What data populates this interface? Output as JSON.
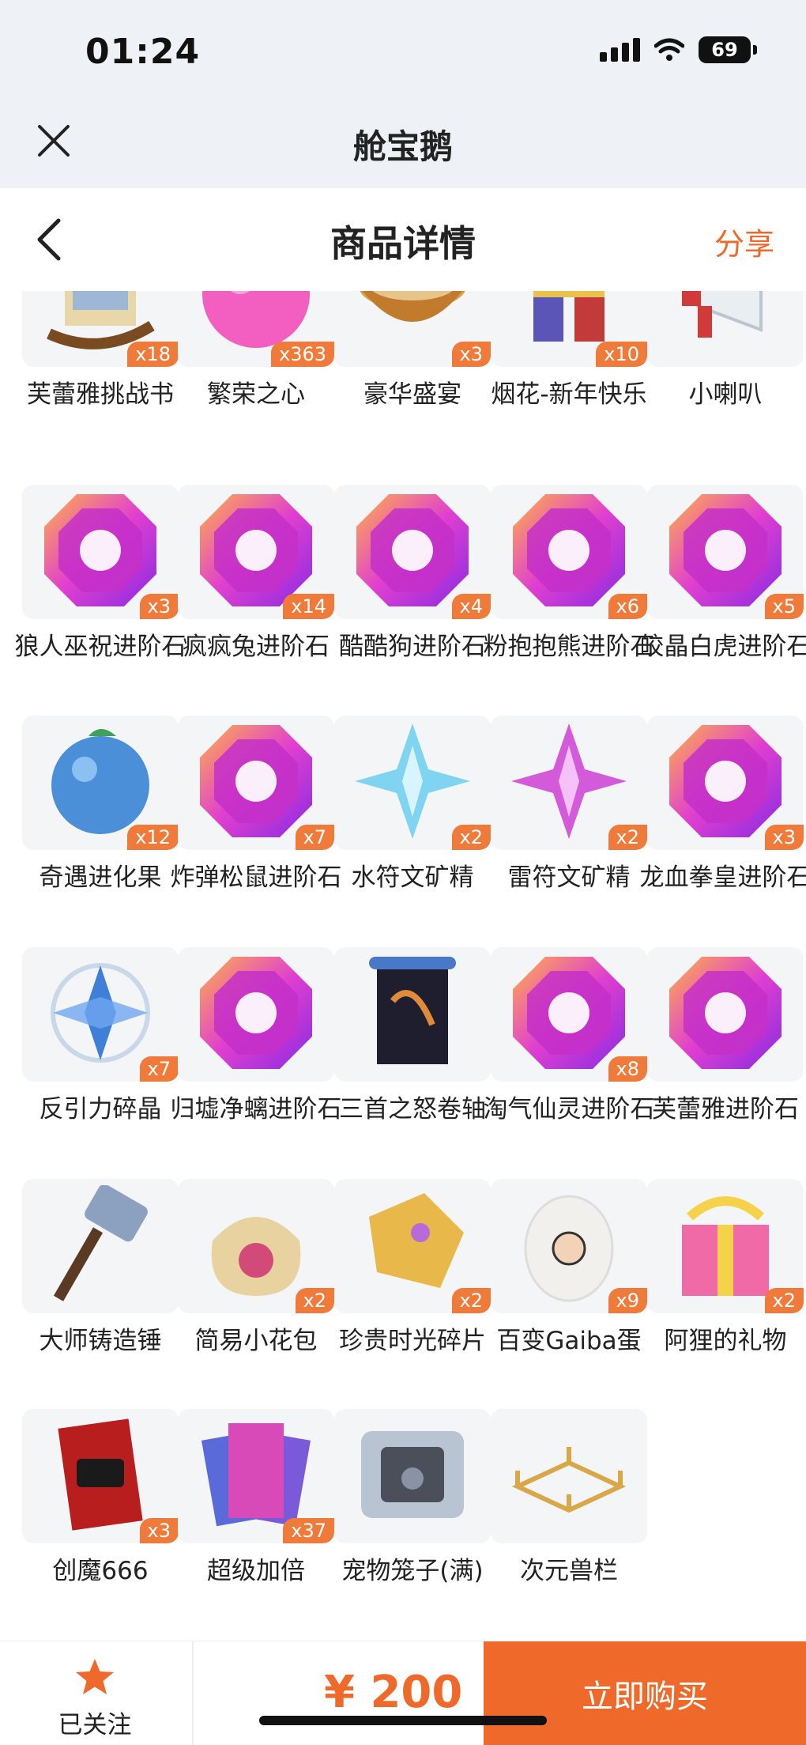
{
  "status_bar": {
    "time": "01:24",
    "battery": "69"
  },
  "app": {
    "title": "舱宝鹅"
  },
  "header": {
    "title": "商品详情",
    "share_label": "分享"
  },
  "items": [
    {
      "name": "芙蕾雅挑战书",
      "qty": "x18",
      "icon": "wanted-poster-icon"
    },
    {
      "name": "繁荣之心",
      "qty": "x363",
      "icon": "pink-heart-orb-icon"
    },
    {
      "name": "豪华盛宴",
      "qty": "x3",
      "icon": "feast-bowl-icon"
    },
    {
      "name": "烟花-新年快乐",
      "qty": "x10",
      "icon": "fireworks-icon"
    },
    {
      "name": "小喇叭",
      "qty": "",
      "icon": "megaphone-icon"
    },
    {
      "name": "狼人巫祝进阶石",
      "qty": "x3",
      "icon": "evolution-stone-icon"
    },
    {
      "name": "疯疯兔进阶石",
      "qty": "x14",
      "icon": "evolution-stone-icon"
    },
    {
      "name": "酷酷狗进阶石",
      "qty": "x4",
      "icon": "evolution-stone-icon"
    },
    {
      "name": "粉抱抱熊进阶石",
      "qty": "x6",
      "icon": "evolution-stone-icon"
    },
    {
      "name": "皎晶白虎进阶石",
      "qty": "x5",
      "icon": "evolution-stone-icon"
    },
    {
      "name": "奇遇进化果",
      "qty": "x12",
      "icon": "blue-fruit-icon"
    },
    {
      "name": "炸弹松鼠进阶石",
      "qty": "x7",
      "icon": "evolution-stone-icon"
    },
    {
      "name": "水符文矿精",
      "qty": "x2",
      "icon": "blue-crystal-icon"
    },
    {
      "name": "雷符文矿精",
      "qty": "x2",
      "icon": "purple-crystal-icon"
    },
    {
      "name": "龙血拳皇进阶石",
      "qty": "x3",
      "icon": "evolution-stone-icon"
    },
    {
      "name": "反引力碎晶",
      "qty": "x7",
      "icon": "anti-gravity-shard-icon"
    },
    {
      "name": "归墟净螭进阶石",
      "qty": "",
      "icon": "evolution-stone-icon"
    },
    {
      "name": "三首之怒卷轴",
      "qty": "",
      "icon": "scroll-icon"
    },
    {
      "name": "淘气仙灵进阶石",
      "qty": "x8",
      "icon": "evolution-stone-icon"
    },
    {
      "name": "芙蕾雅进阶石",
      "qty": "",
      "icon": "evolution-stone-icon"
    },
    {
      "name": "大师铸造锤",
      "qty": "",
      "icon": "hammer-icon"
    },
    {
      "name": "简易小花包",
      "qty": "x2",
      "icon": "flower-bag-icon"
    },
    {
      "name": "珍贵时光碎片",
      "qty": "x2",
      "icon": "time-shard-icon"
    },
    {
      "name": "百变Gaiba蛋",
      "qty": "x9",
      "icon": "egg-icon"
    },
    {
      "name": "阿狸的礼物",
      "qty": "x2",
      "icon": "gift-box-icon"
    },
    {
      "name": "创魔666",
      "qty": "x3",
      "icon": "card-666-icon"
    },
    {
      "name": "超级加倍",
      "qty": "x37",
      "icon": "super-double-cards-icon"
    },
    {
      "name": "宠物笼子(满)",
      "qty": "",
      "icon": "pet-cage-icon"
    },
    {
      "name": "次元兽栏",
      "qty": "",
      "icon": "fence-icon"
    }
  ],
  "bottom": {
    "follow_label": "已关注",
    "price": "¥ 200",
    "buy_label": "立即购买"
  },
  "colors": {
    "accent": "#ef6a2a",
    "qty_badge": "#f07a3a",
    "header_bg": "#eef1f6"
  }
}
